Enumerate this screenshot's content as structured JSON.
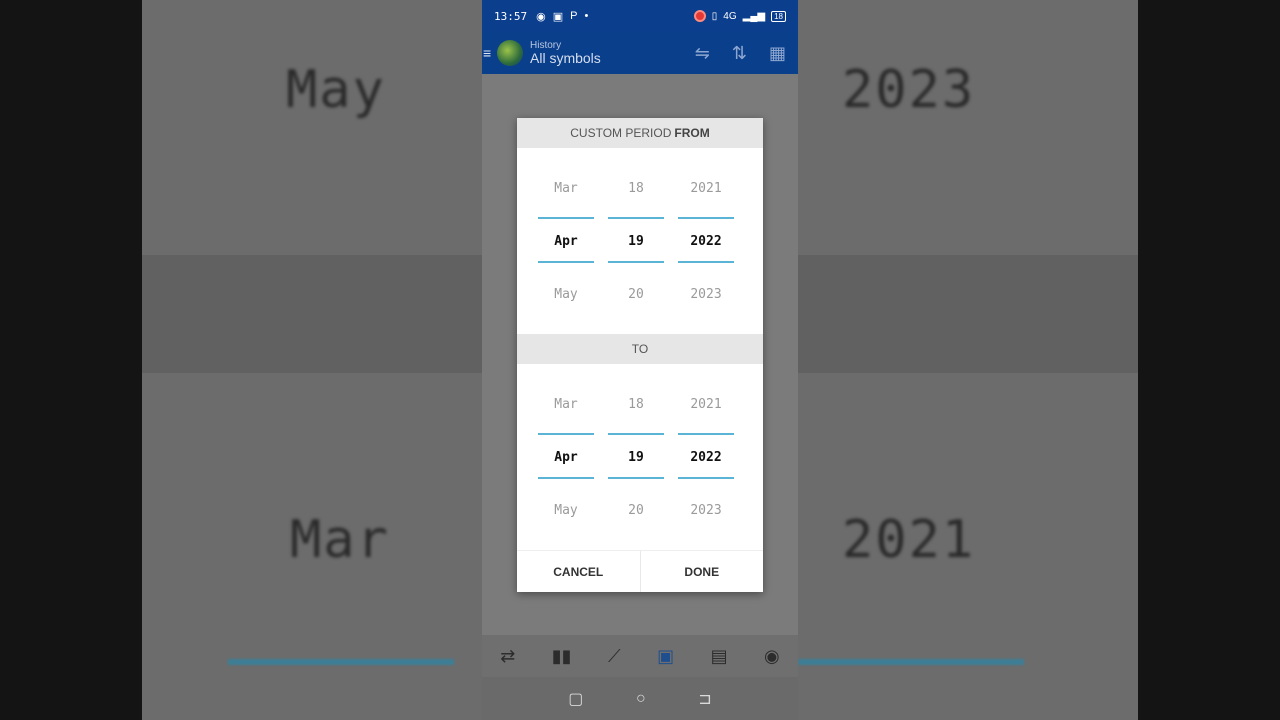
{
  "status_bar": {
    "time": "13:57",
    "left_icons": [
      "◉",
      "▣",
      "P",
      "•"
    ],
    "right_text": "4G",
    "battery": "18"
  },
  "app_bar": {
    "subtitle": "History",
    "title": "All symbols"
  },
  "background": {
    "month_top": "May",
    "year_top": "2023",
    "month_bottom": "Mar",
    "year_bottom": "2021"
  },
  "dialog": {
    "from_label_prefix": "CUSTOM PERIOD",
    "from_label_bold": "FROM",
    "to_label": "TO",
    "from_picker": {
      "month": {
        "prev": "Mar",
        "current": "Apr",
        "next": "May"
      },
      "day": {
        "prev": "18",
        "current": "19",
        "next": "20"
      },
      "year": {
        "prev": "2021",
        "current": "2022",
        "next": "2023"
      }
    },
    "to_picker": {
      "month": {
        "prev": "Mar",
        "current": "Apr",
        "next": "May"
      },
      "day": {
        "prev": "18",
        "current": "19",
        "next": "20"
      },
      "year": {
        "prev": "2021",
        "current": "2022",
        "next": "2023"
      }
    },
    "cancel_label": "CANCEL",
    "done_label": "DONE"
  },
  "colors": {
    "app_bar": "#0a3f8c",
    "divider": "#5ab4d6"
  }
}
